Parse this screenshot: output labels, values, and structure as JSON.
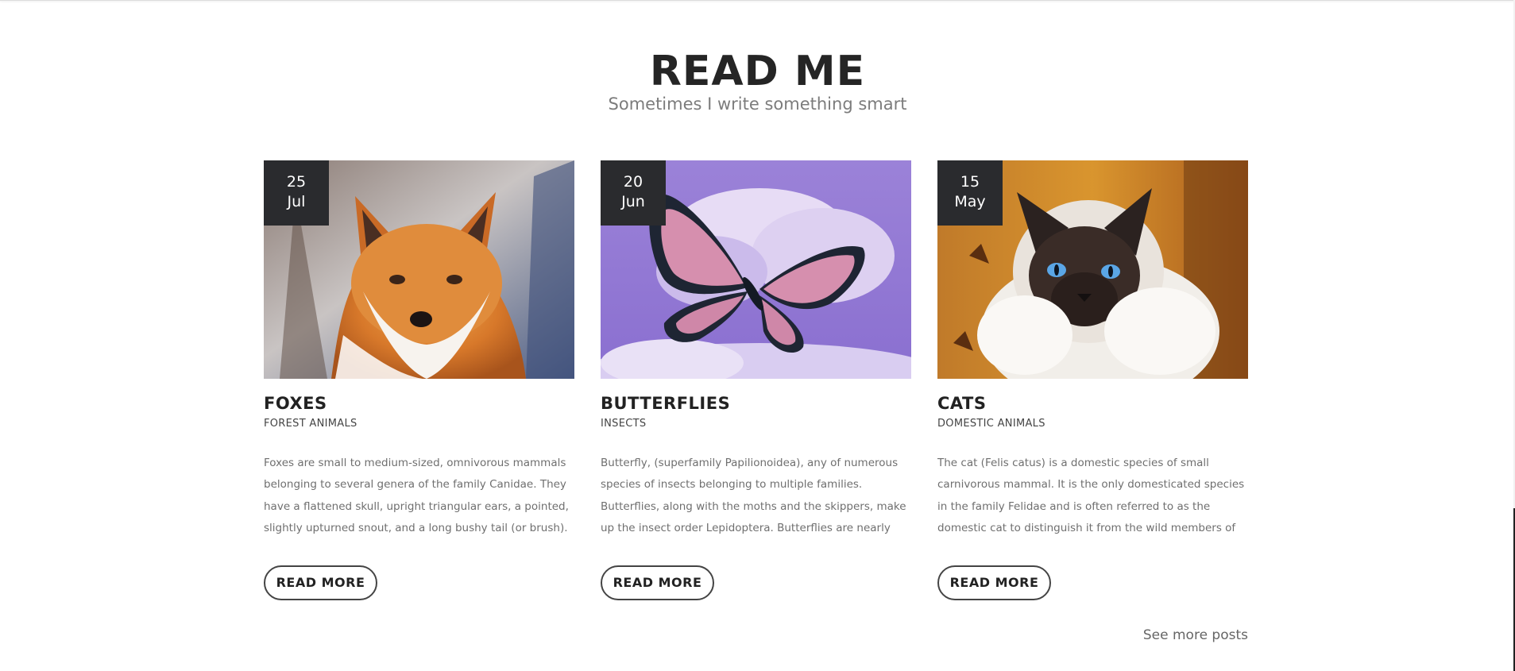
{
  "section": {
    "title": "READ ME",
    "subtitle": "Sometimes I write something smart"
  },
  "posts": [
    {
      "day": "25",
      "month": "Jul",
      "title": "FOXES",
      "category": "FOREST ANIMALS",
      "excerpt": "Foxes are small to medium-sized, omnivorous mammals belonging to several genera of the family Canidae. They have a flattened skull, upright triangular ears, a pointed, slightly upturned snout, and a long bushy tail (or brush).",
      "button_label": "READ MORE",
      "image_icon": "fox-photo"
    },
    {
      "day": "20",
      "month": "Jun",
      "title": "BUTTERFLIES",
      "category": "INSECTS",
      "excerpt": "Butterfly, (superfamily Papilionoidea), any of numerous species of insects belonging to multiple families. Butterflies, along with the moths and the skippers, make up the insect order Lepidoptera. Butterflies are nearly",
      "button_label": "READ MORE",
      "image_icon": "butterfly-photo"
    },
    {
      "day": "15",
      "month": "May",
      "title": "CATS",
      "category": "DOMESTIC ANIMALS",
      "excerpt": "The cat (Felis catus) is a domestic species of small carnivorous mammal. It is the only domesticated species in the family Felidae and is often referred to as the domestic cat to distinguish it from the wild members of",
      "button_label": "READ MORE",
      "image_icon": "cat-photo"
    }
  ],
  "footer": {
    "see_more_label": "See more posts"
  },
  "colors": {
    "badge_bg": "#2a2b2e",
    "title": "#252525",
    "subtitle": "#7c7c7c",
    "body_text": "#6f6f6f"
  }
}
